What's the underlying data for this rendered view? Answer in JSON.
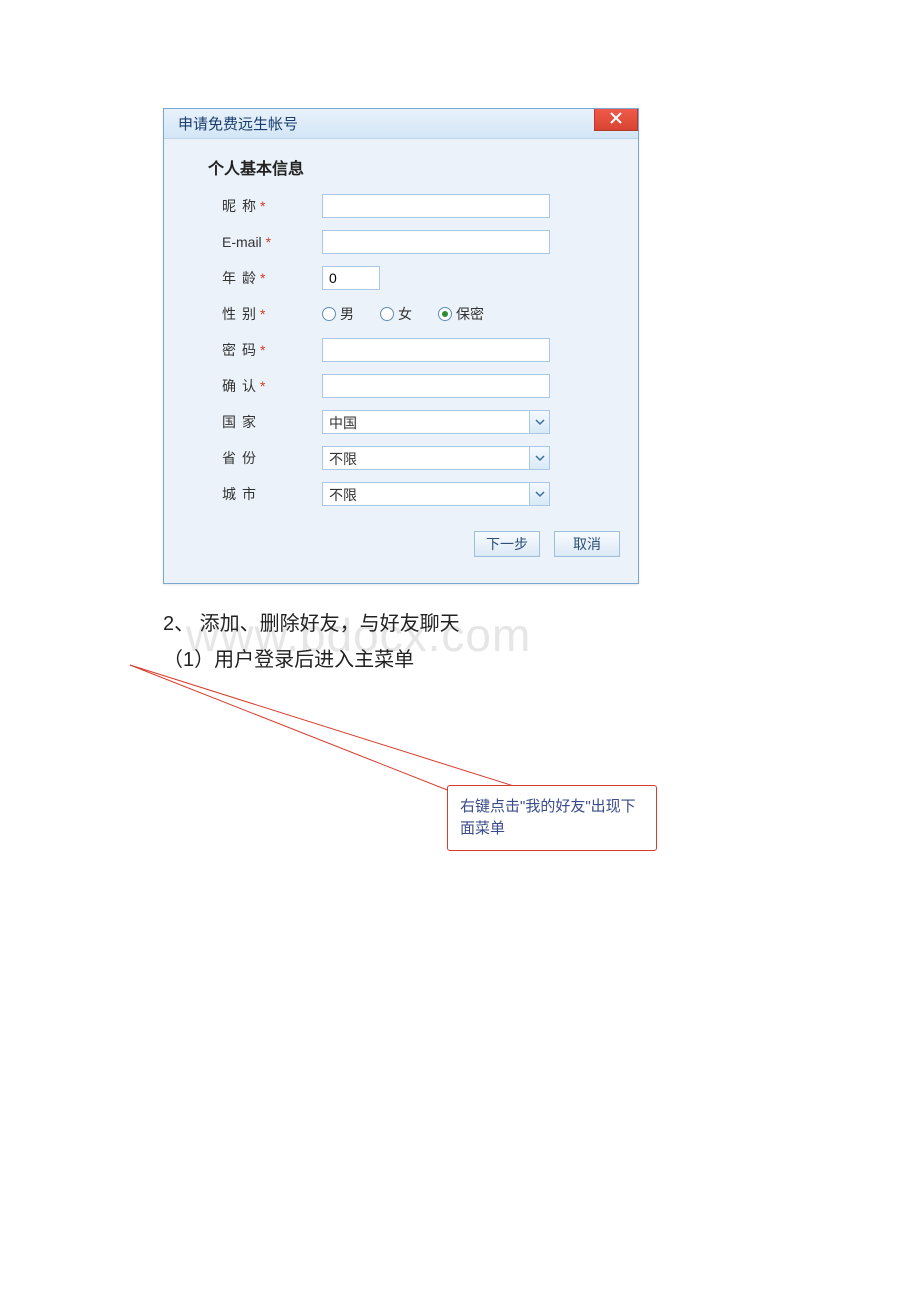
{
  "dialog": {
    "title": "申请免费远生帐号",
    "section_title": "个人基本信息",
    "fields": {
      "nickname": {
        "label_a": "昵",
        "label_b": "称",
        "required": "*",
        "value": ""
      },
      "email": {
        "label": "E-mail",
        "required": "*",
        "value": ""
      },
      "age": {
        "label_a": "年",
        "label_b": "龄",
        "required": "*",
        "value": "0"
      },
      "gender": {
        "label_a": "性",
        "label_b": "别",
        "required": "*",
        "options": {
          "male": "男",
          "female": "女",
          "secret": "保密"
        },
        "selected": "secret"
      },
      "password": {
        "label_a": "密",
        "label_b": "码",
        "required": "*",
        "value": ""
      },
      "confirm": {
        "label_a": "确",
        "label_b": "认",
        "required": "*",
        "value": ""
      },
      "country": {
        "label_a": "国",
        "label_b": "家",
        "value": "中国"
      },
      "province": {
        "label_a": "省",
        "label_b": "份",
        "value": "不限"
      },
      "city": {
        "label_a": "城",
        "label_b": "市",
        "value": "不限"
      }
    },
    "buttons": {
      "next": "下一步",
      "cancel": "取消"
    }
  },
  "document": {
    "line1": "2、 添加、删除好友，与好友聊天",
    "line2": "（1）用户登录后进入主菜单"
  },
  "watermark": "www.bdocx.com",
  "callout": "右键点击\"我的好友\"出现下面菜单"
}
